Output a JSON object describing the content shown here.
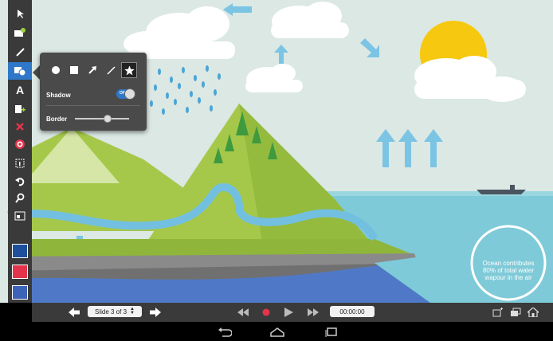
{
  "toolbar": {
    "tools": [
      {
        "name": "pointer-tool-icon",
        "interactable": true
      },
      {
        "name": "add-image-icon",
        "interactable": true
      },
      {
        "name": "pen-icon",
        "interactable": true
      },
      {
        "name": "shapes-icon",
        "interactable": true,
        "active": true
      },
      {
        "name": "text-icon",
        "interactable": true
      },
      {
        "name": "add-note-icon",
        "interactable": true
      },
      {
        "name": "delete-icon",
        "interactable": true
      },
      {
        "name": "target-icon",
        "interactable": true
      },
      {
        "name": "info-frame-icon",
        "interactable": true
      },
      {
        "name": "undo-icon",
        "interactable": true
      },
      {
        "name": "magnify-icon",
        "interactable": true
      },
      {
        "name": "slide-icon",
        "interactable": true
      }
    ],
    "text_tool_glyph": "A",
    "colors": [
      "#1e4f9c",
      "#e3344b",
      "#3d63b8"
    ],
    "active_color": "#2f78c9"
  },
  "shape_popup": {
    "shapes": [
      "circle-shape-icon",
      "square-shape-icon",
      "arrow-shape-icon",
      "line-shape-icon",
      "star-shape-icon"
    ],
    "selected_shape": "star-shape-icon",
    "shadow_label": "Shadow",
    "shadow_toggle_text": "ON",
    "shadow_on": true,
    "border_label": "Border",
    "border_level": 0.6
  },
  "canvas": {
    "ocean_caption_lines": [
      "Ocean contributes",
      "80% of total water",
      "wapour in the air"
    ],
    "sky_color": "#dbe8e4",
    "sea_color": "#7fcad8",
    "sun_color": "#f6c80f"
  },
  "playback": {
    "slide_indicator": "Slide 3 of 3",
    "timer": "00:00:00",
    "record_color": "#e3344b"
  }
}
